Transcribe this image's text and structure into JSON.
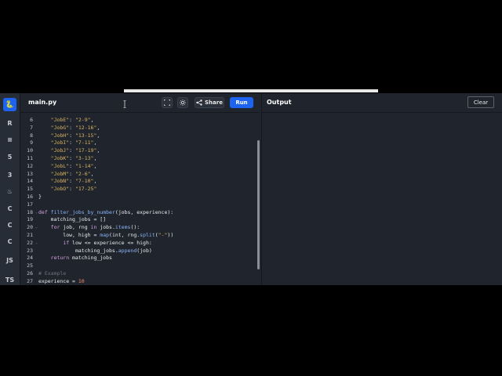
{
  "editor": {
    "file_tab": "main.py",
    "share_label": "Share",
    "run_label": "Run"
  },
  "output": {
    "title": "Output",
    "clear_label": "Clear"
  },
  "rail": {
    "items": [
      {
        "name": "python-icon",
        "glyph": "🐍"
      },
      {
        "name": "r-icon",
        "glyph": "R"
      },
      {
        "name": "database-icon",
        "glyph": "≡"
      },
      {
        "name": "html5-icon",
        "glyph": "5"
      },
      {
        "name": "css3-icon",
        "glyph": "3"
      },
      {
        "name": "java-icon",
        "glyph": "♨"
      },
      {
        "name": "c-icon",
        "glyph": "C"
      },
      {
        "name": "cpp-icon",
        "glyph": "C"
      },
      {
        "name": "csharp-icon",
        "glyph": "C"
      },
      {
        "name": "javascript-icon",
        "glyph": "JS"
      },
      {
        "name": "typescript-icon",
        "glyph": "TS"
      },
      {
        "name": "sql-icon",
        "glyph": "≣"
      }
    ]
  },
  "code": {
    "lines": [
      {
        "n": "6",
        "text": "    \"JobE\": \"2-9\","
      },
      {
        "n": "7",
        "text": "    \"JobG\": \"12-16\","
      },
      {
        "n": "8",
        "text": "    \"JobH\": \"13-15\","
      },
      {
        "n": "9",
        "text": "    \"JobI\": \"7-11\","
      },
      {
        "n": "10",
        "text": "    \"JobJ\": \"17-19\","
      },
      {
        "n": "11",
        "text": "    \"JobK\": \"3-13\","
      },
      {
        "n": "12",
        "text": "    \"JobL\": \"1-14\","
      },
      {
        "n": "13",
        "text": "    \"JobM\": \"2-6\","
      },
      {
        "n": "14",
        "text": "    \"JobN\": \"7-10\","
      },
      {
        "n": "15",
        "text": "    \"JobO\": \"17-25\""
      },
      {
        "n": "16",
        "text": "}"
      },
      {
        "n": "17",
        "text": ""
      },
      {
        "n": "18",
        "text": "def filter_jobs_by_number(jobs, experience):"
      },
      {
        "n": "19",
        "text": "    matching_jobs = []"
      },
      {
        "n": "20",
        "text": "    for job, rng in jobs.items():"
      },
      {
        "n": "21",
        "text": "        low, high = map(int, rng.split(\"-\"))"
      },
      {
        "n": "22",
        "text": "        if low <= experience <= high:"
      },
      {
        "n": "23",
        "text": "            matching_jobs.append(job)"
      },
      {
        "n": "24",
        "text": "    return matching_jobs"
      },
      {
        "n": "25",
        "text": ""
      },
      {
        "n": "26",
        "text": "# Example"
      },
      {
        "n": "27",
        "text": "experience = 10"
      }
    ]
  }
}
